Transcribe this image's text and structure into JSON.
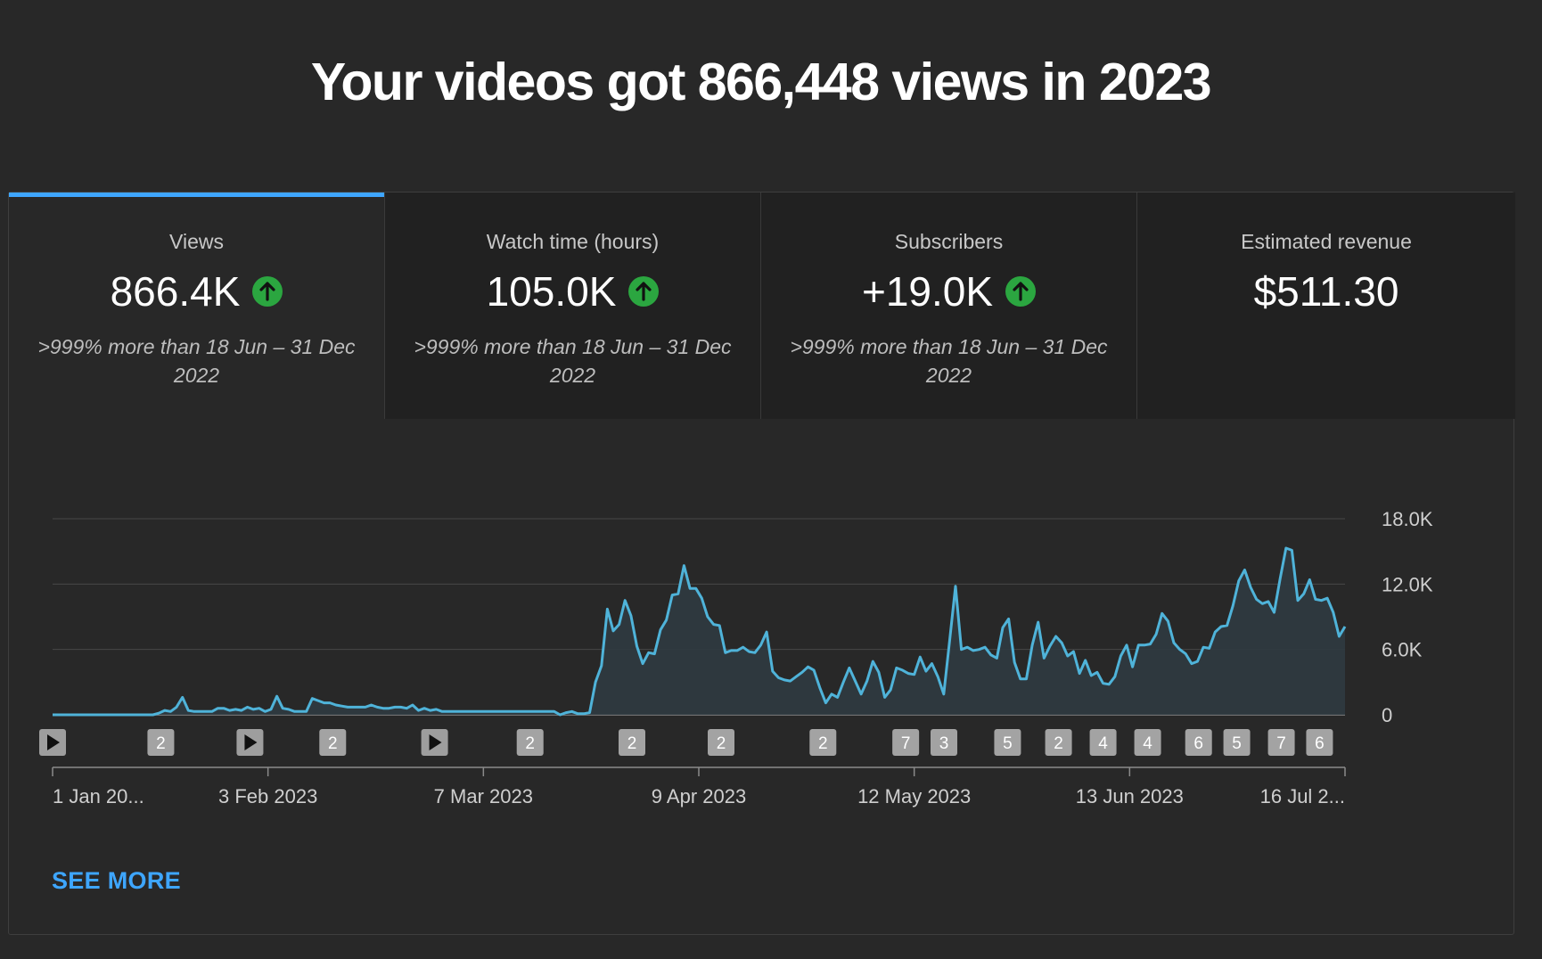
{
  "headline": "Your videos got 866,448 views in 2023",
  "tabs": [
    {
      "label": "Views",
      "value": "866.4K",
      "trend": "up",
      "compare": ">999% more than 18 Jun – 31 Dec 2022"
    },
    {
      "label": "Watch time (hours)",
      "value": "105.0K",
      "trend": "up",
      "compare": ">999% more than 18 Jun – 31 Dec 2022"
    },
    {
      "label": "Subscribers",
      "value": "+19.0K",
      "trend": "up",
      "compare": ">999% more than 18 Jun – 31 Dec 2022"
    },
    {
      "label": "Estimated revenue",
      "value": "$511.30",
      "trend": "",
      "compare": ""
    }
  ],
  "see_more": "SEE MORE",
  "colors": {
    "accent": "#3ea6ff",
    "line": "#4fb3d9",
    "up": "#2ba640"
  },
  "chart_data": {
    "type": "area",
    "y_ticks": [
      "0",
      "6.0K",
      "12.0K",
      "18.0K"
    ],
    "ylim": [
      0,
      18000
    ],
    "x_ticks": [
      "1 Jan 20...",
      "3 Feb 2023",
      "7 Mar 2023",
      "9 Apr 2023",
      "12 May 2023",
      "13 Jun 2023",
      "16 Jul 2..."
    ],
    "x_range_days": [
      0,
      203
    ],
    "series": [
      {
        "values": [
          0,
          0,
          0,
          0,
          0,
          0,
          0,
          0,
          0,
          0,
          0,
          0,
          0,
          0,
          0,
          0,
          0,
          0,
          150,
          400,
          300,
          700,
          1600,
          400,
          300,
          300,
          300,
          300,
          600,
          600,
          400,
          500,
          400,
          700,
          500,
          600,
          300,
          500,
          1700,
          600,
          500,
          300,
          300,
          300,
          1500,
          1300,
          1100,
          1100,
          900,
          800,
          700,
          700,
          700,
          700,
          900,
          700,
          600,
          600,
          700,
          700,
          600,
          900,
          400,
          600,
          400,
          500,
          300,
          300,
          300,
          300,
          300,
          300,
          300,
          300,
          300,
          300,
          300,
          300,
          300,
          300,
          300,
          300,
          300,
          300,
          300,
          300,
          0,
          200,
          300,
          100,
          100,
          200,
          3000,
          4500,
          9700,
          7700,
          8300,
          10500,
          9100,
          6300,
          4700,
          5700,
          5600,
          7800,
          8700,
          11000,
          11100,
          13700,
          11600,
          11600,
          10700,
          9000,
          8300,
          8200,
          5700,
          5900,
          5900,
          6200,
          5800,
          5700,
          6400,
          7600,
          4000,
          3400,
          3200,
          3100,
          3500,
          3900,
          4400,
          4100,
          2500,
          1100,
          1900,
          1600,
          3000,
          4300,
          3100,
          1900,
          3100,
          4900,
          3900,
          1600,
          2300,
          4300,
          4100,
          3800,
          3700,
          5300,
          4000,
          4700,
          3500,
          1900,
          6800,
          11800,
          6000,
          6200,
          5900,
          6000,
          6200,
          5500,
          5200,
          8000,
          8800,
          4800,
          3300,
          3300,
          6400,
          8500,
          5200,
          6300,
          7200,
          6600,
          5400,
          5800,
          3800,
          5000,
          3600,
          3900,
          2900,
          2800,
          3500,
          5400,
          6400,
          4400,
          6400,
          6400,
          6500,
          7400,
          9300,
          8600,
          6600,
          6000,
          5600,
          4700,
          4900,
          6200,
          6100,
          7600,
          8100,
          8200,
          10000,
          12300,
          13300,
          11700,
          10600,
          10200,
          10400,
          9400,
          12500,
          15300,
          15100,
          10500,
          11100,
          12400,
          10600,
          10500,
          10700,
          9400,
          7200,
          8100
        ]
      }
    ],
    "markers": [
      {
        "day": 0,
        "kind": "video",
        "label": ""
      },
      {
        "day": 17,
        "kind": "count",
        "label": "2"
      },
      {
        "day": 31,
        "kind": "video",
        "label": ""
      },
      {
        "day": 44,
        "kind": "count",
        "label": "2"
      },
      {
        "day": 60,
        "kind": "video",
        "label": ""
      },
      {
        "day": 75,
        "kind": "count",
        "label": "2"
      },
      {
        "day": 91,
        "kind": "count",
        "label": "2"
      },
      {
        "day": 105,
        "kind": "count",
        "label": "2"
      },
      {
        "day": 121,
        "kind": "count",
        "label": "2"
      },
      {
        "day": 134,
        "kind": "count",
        "label": "7"
      },
      {
        "day": 140,
        "kind": "count",
        "label": "3"
      },
      {
        "day": 150,
        "kind": "count",
        "label": "5"
      },
      {
        "day": 158,
        "kind": "count",
        "label": "2"
      },
      {
        "day": 165,
        "kind": "count",
        "label": "4"
      },
      {
        "day": 172,
        "kind": "count",
        "label": "4"
      },
      {
        "day": 180,
        "kind": "count",
        "label": "6"
      },
      {
        "day": 186,
        "kind": "count",
        "label": "5"
      },
      {
        "day": 193,
        "kind": "count",
        "label": "7"
      },
      {
        "day": 199,
        "kind": "count",
        "label": "6"
      }
    ],
    "grid": true
  }
}
